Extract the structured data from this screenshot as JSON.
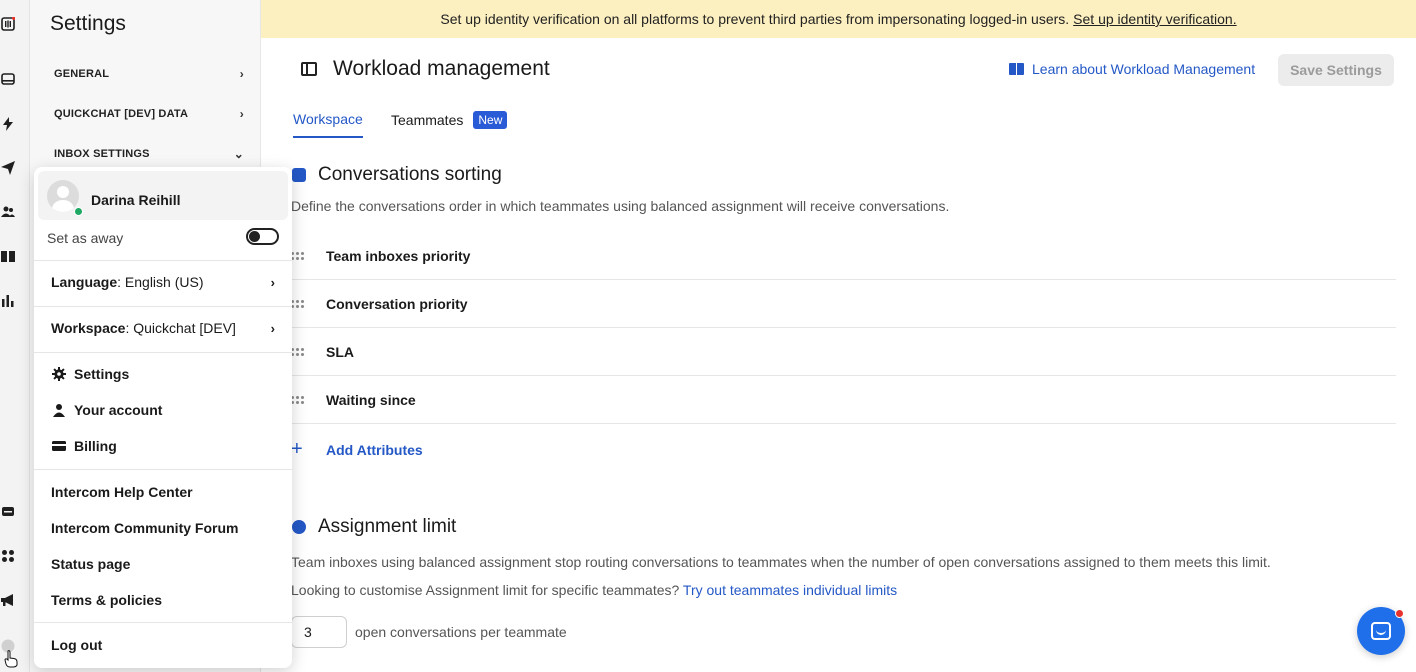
{
  "banner": {
    "text": "Set up identity verification on all platforms to prevent third parties from impersonating logged-in users.",
    "link": "Set up identity verification."
  },
  "sidebar": {
    "title": "Settings",
    "items": [
      {
        "label": "GENERAL",
        "chevron": "›"
      },
      {
        "label": "QUICKCHAT [DEV] DATA",
        "chevron": "›"
      },
      {
        "label": "INBOX SETTINGS",
        "chevron": "⌄"
      }
    ]
  },
  "header": {
    "title": "Workload management",
    "learn_link": "Learn about Workload Management",
    "save_button": "Save Settings"
  },
  "tabs": [
    {
      "label": "Workspace",
      "active": true
    },
    {
      "label": "Teammates",
      "badge": "New"
    }
  ],
  "sorting": {
    "title": "Conversations sorting",
    "description": "Define the conversations order in which teammates using balanced assignment will receive conversations.",
    "rows": [
      "Team inboxes priority",
      "Conversation priority",
      "SLA",
      "Waiting since"
    ],
    "add_label": "Add Attributes",
    "add_icon": "+"
  },
  "assignment": {
    "title": "Assignment limit",
    "description": "Team inboxes using balanced assignment stop routing conversations to teammates when the number of open conversations assigned to them meets this limit.",
    "prompt": "Looking to customise Assignment limit for specific teammates?",
    "prompt_link": "Try out teammates individual limits",
    "limit_value": "3",
    "limit_suffix": "open conversations per teammate"
  },
  "menu": {
    "user_name": "Darina Reihill",
    "away_label": "Set as away",
    "language_key": "Language",
    "language_value": ": English (US)",
    "workspace_key": "Workspace",
    "workspace_value": ": Quickchat [DEV]",
    "chevron": "›",
    "items": [
      "Settings",
      "Your account",
      "Billing"
    ],
    "links": [
      "Intercom Help Center",
      "Intercom Community Forum",
      "Status page",
      "Terms & policies"
    ],
    "logout": "Log out"
  },
  "colors": {
    "accent": "#2458c6",
    "banner_bg": "#fcefc0",
    "badge_bg": "#2a5bd7",
    "online": "#1ea863",
    "notification": "#e6312c",
    "messenger": "#1f6fea"
  }
}
